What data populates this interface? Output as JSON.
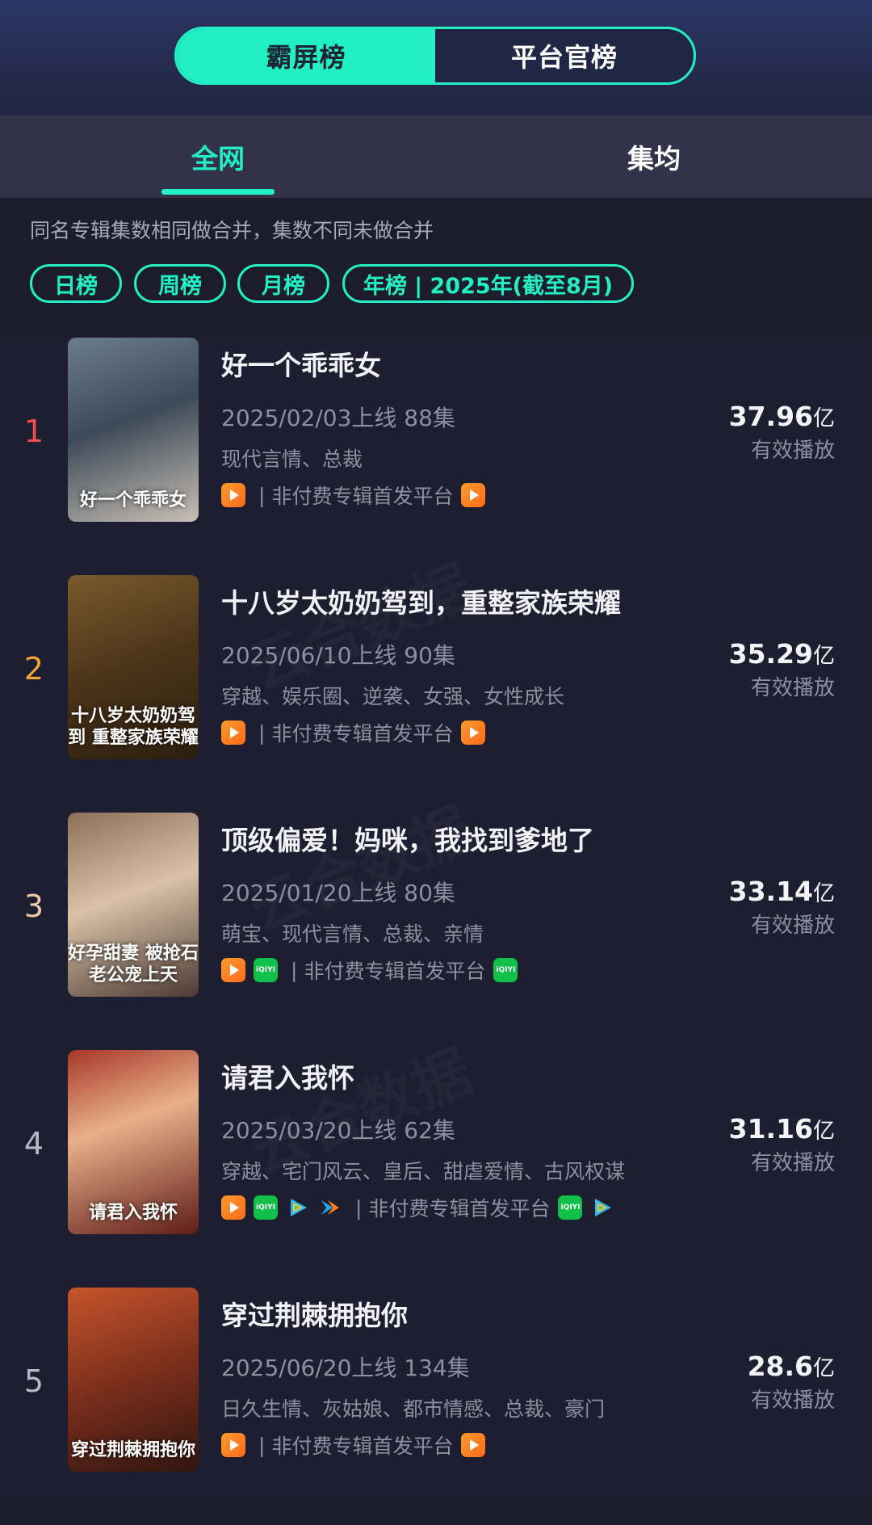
{
  "top_toggle": {
    "active": "霸屏榜",
    "inactive": "平台官榜"
  },
  "tabs": [
    "全网",
    "集均"
  ],
  "note": "同名专辑集数相同做合并，集数不同未做合并",
  "filters": [
    "日榜",
    "周榜",
    "月榜",
    "年榜 | 2025年(截至8月)"
  ],
  "play_label": "有效播放",
  "play_unit": "亿",
  "platform_text": "非付费专辑首发平台",
  "accent": "#22f0c4",
  "rank_colors": [
    "#f04f46",
    "#f5a43a",
    "#e8c9a8",
    "#b8b8c4",
    "#b8b8c4"
  ],
  "items": [
    {
      "rank": "1",
      "title": "好一个乖乖女",
      "release": "2025/02/03上线 88集",
      "tags": "现代言情、总裁",
      "plays": "37.96",
      "platform_icons": [
        "mango"
      ],
      "first_icons": [
        "mango"
      ],
      "poster_text": "好一个乖乖女"
    },
    {
      "rank": "2",
      "title": "十八岁太奶奶驾到，重整家族荣耀",
      "release": "2025/06/10上线 90集",
      "tags": "穿越、娱乐圈、逆袭、女强、女性成长",
      "plays": "35.29",
      "platform_icons": [
        "mango"
      ],
      "first_icons": [
        "mango"
      ],
      "poster_text": "十八岁太奶奶驾到 重整家族荣耀"
    },
    {
      "rank": "3",
      "title": "顶级偏爱！妈咪，我找到爹地了",
      "release": "2025/01/20上线 80集",
      "tags": "萌宝、现代言情、总裁、亲情",
      "plays": "33.14",
      "platform_icons": [
        "mango",
        "iqiyi"
      ],
      "first_icons": [
        "iqiyi"
      ],
      "poster_text": "好孕甜妻 被抢石老公宠上天"
    },
    {
      "rank": "4",
      "title": "请君入我怀",
      "release": "2025/03/20上线 62集",
      "tags": "穿越、宅门风云、皇后、甜虐爱情、古风权谋",
      "plays": "31.16",
      "platform_icons": [
        "mango",
        "iqiyi",
        "tencent",
        "youku"
      ],
      "first_icons": [
        "iqiyi",
        "tencent"
      ],
      "poster_text": "请君入我怀"
    },
    {
      "rank": "5",
      "title": "穿过荆棘拥抱你",
      "release": "2025/06/20上线 134集",
      "tags": "日久生情、灰姑娘、都市情感、总裁、豪门",
      "plays": "28.6",
      "platform_icons": [
        "mango"
      ],
      "first_icons": [
        "mango"
      ],
      "poster_text": "穿过荆棘拥抱你"
    }
  ]
}
